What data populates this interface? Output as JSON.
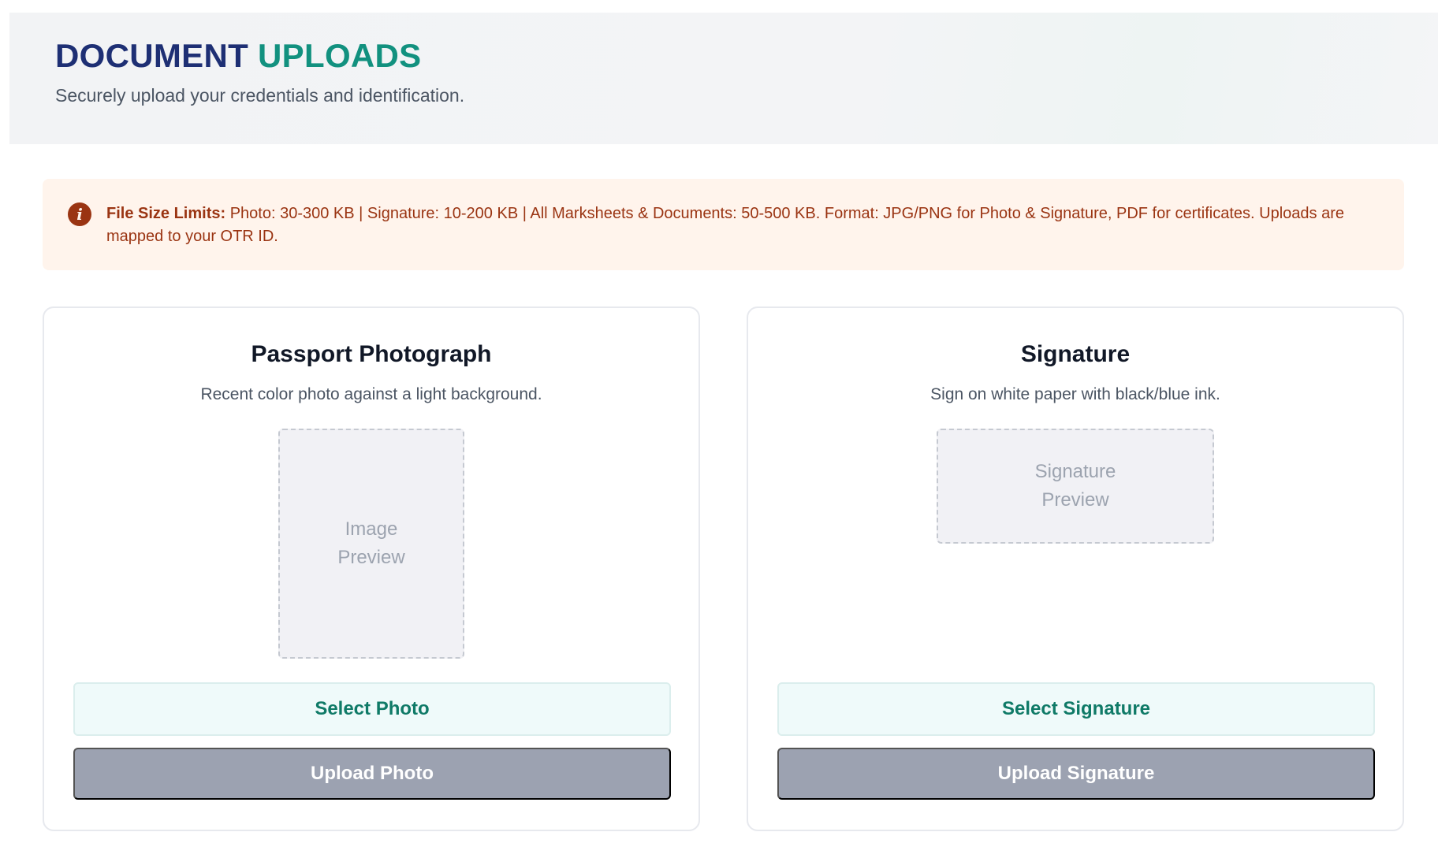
{
  "header": {
    "title_part1": "DOCUMENT",
    "title_part2": "UPLOADS",
    "subtitle": "Securely upload your credentials and identification.",
    "title_color_1": "#1e2f74",
    "title_color_2": "#12917f"
  },
  "notice": {
    "icon": "info-icon",
    "lead": "File Size Limits:",
    "text": " Photo: 30-300 KB | Signature: 10-200 KB | All Marksheets & Documents: 50-500 KB. Format: JPG/PNG for Photo & Signature, PDF for certificates. Uploads are mapped to your OTR ID."
  },
  "cards": [
    {
      "title": "Passport Photograph",
      "description": "Recent color photo against a light background.",
      "preview_line1": "Image",
      "preview_line2": "Preview",
      "select_label": "Select Photo",
      "upload_label": "Upload Photo"
    },
    {
      "title": "Signature",
      "description": "Sign on white paper with black/blue ink.",
      "preview_line1": "Signature",
      "preview_line2": "Preview",
      "select_label": "Select Signature",
      "upload_label": "Upload Signature"
    }
  ],
  "colors": {
    "accent_teal": "#0f7a67",
    "upload_disabled": "#9ca2b1",
    "notice_bg": "#fff4ec",
    "notice_text": "#9a3412"
  }
}
